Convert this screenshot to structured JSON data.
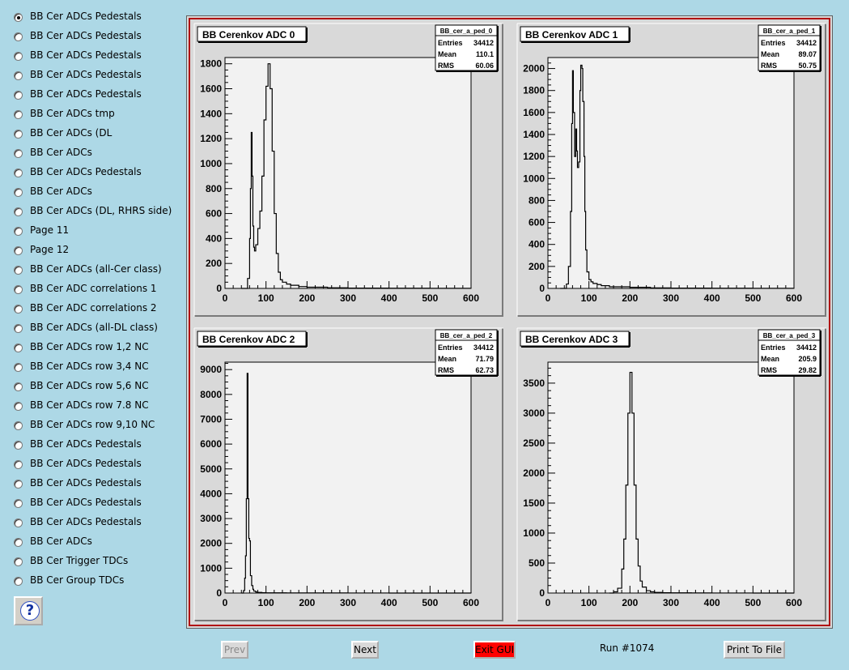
{
  "sidebar": {
    "items": [
      {
        "label": "BB Cer ADCs Pedestals",
        "checked": true
      },
      {
        "label": "BB Cer ADCs Pedestals",
        "checked": false
      },
      {
        "label": "BB Cer ADCs Pedestals",
        "checked": false
      },
      {
        "label": "BB Cer ADCs Pedestals",
        "checked": false
      },
      {
        "label": "BB Cer ADCs Pedestals",
        "checked": false
      },
      {
        "label": "BB Cer ADCs tmp",
        "checked": false
      },
      {
        "label": "BB Cer ADCs (DL",
        "checked": false
      },
      {
        "label": "BB Cer ADCs",
        "checked": false
      },
      {
        "label": "BB Cer ADCs Pedestals",
        "checked": false
      },
      {
        "label": "BB Cer ADCs",
        "checked": false
      },
      {
        "label": "BB Cer ADCs (DL, RHRS side)",
        "checked": false
      },
      {
        "label": "Page 11",
        "checked": false
      },
      {
        "label": "Page 12",
        "checked": false
      },
      {
        "label": "BB Cer ADCs (all-Cer class)",
        "checked": false
      },
      {
        "label": "BB Cer ADC correlations 1",
        "checked": false
      },
      {
        "label": "BB Cer ADC correlations 2",
        "checked": false
      },
      {
        "label": "BB Cer ADCs (all-DL class)",
        "checked": false
      },
      {
        "label": "BB Cer ADCs row 1,2 NC",
        "checked": false
      },
      {
        "label": "BB Cer ADCs row 3,4 NC",
        "checked": false
      },
      {
        "label": "BB Cer ADCs row 5,6 NC",
        "checked": false
      },
      {
        "label": "BB Cer ADCs row 7.8 NC",
        "checked": false
      },
      {
        "label": "BB Cer ADCs row 9,10 NC",
        "checked": false
      },
      {
        "label": "BB Cer ADCs Pedestals",
        "checked": false
      },
      {
        "label": "BB Cer ADCs Pedestals",
        "checked": false
      },
      {
        "label": "BB Cer ADCs Pedestals",
        "checked": false
      },
      {
        "label": "BB Cer ADCs Pedestals",
        "checked": false
      },
      {
        "label": "BB Cer ADCs Pedestals",
        "checked": false
      },
      {
        "label": "BB Cer ADCs",
        "checked": false
      },
      {
        "label": "BB Cer Trigger TDCs",
        "checked": false
      },
      {
        "label": "BB Cer Group TDCs",
        "checked": false
      }
    ],
    "help_icon": "question-mark-icon",
    "help_symbol": "?"
  },
  "bottom_bar": {
    "prev_label": "Prev",
    "next_label": "Next",
    "exit_label": "Exit GUI",
    "run_label": "Run #1074",
    "print_label": "Print To File"
  },
  "colors": {
    "background": "#add8e6",
    "canvas_border": "#b01010",
    "exit_button": "#ff0000",
    "plot_area": "#f2f2f2"
  },
  "chart_data": [
    {
      "type": "histogram",
      "title": "BB Cerenkov ADC 0",
      "stats": {
        "name": "BB_cer_a_ped_0",
        "Entries": "34412",
        "Mean": "110.1",
        "RMS": "60.06"
      },
      "xlim": [
        0,
        600
      ],
      "ylim": [
        0,
        1850
      ],
      "xticks": [
        0,
        100,
        200,
        300,
        400,
        500,
        600
      ],
      "yticks": [
        0,
        200,
        400,
        600,
        800,
        1000,
        1200,
        1400,
        1600,
        1800
      ],
      "x": [
        40,
        50,
        55,
        60,
        62,
        64,
        66,
        68,
        70,
        72,
        75,
        80,
        85,
        90,
        95,
        100,
        105,
        110,
        115,
        120,
        125,
        130,
        135,
        140,
        150,
        160,
        180,
        200,
        250,
        300,
        400,
        500,
        600
      ],
      "y": [
        0,
        0,
        80,
        400,
        800,
        1250,
        900,
        500,
        330,
        300,
        350,
        480,
        620,
        900,
        1350,
        1620,
        1800,
        1600,
        1100,
        600,
        280,
        130,
        70,
        50,
        35,
        25,
        15,
        10,
        5,
        3,
        2,
        1,
        0
      ]
    },
    {
      "type": "histogram",
      "title": "BB Cerenkov ADC 1",
      "stats": {
        "name": "BB_cer_a_ped_1",
        "Entries": "34412",
        "Mean": "89.07",
        "RMS": "50.75"
      },
      "xlim": [
        0,
        600
      ],
      "ylim": [
        0,
        2100
      ],
      "xticks": [
        0,
        100,
        200,
        300,
        400,
        500,
        600
      ],
      "yticks": [
        0,
        200,
        400,
        600,
        800,
        1000,
        1200,
        1400,
        1600,
        1800,
        2000
      ],
      "x": [
        30,
        40,
        45,
        50,
        55,
        58,
        60,
        62,
        65,
        68,
        70,
        72,
        75,
        78,
        80,
        83,
        85,
        88,
        90,
        92,
        95,
        100,
        105,
        110,
        120,
        130,
        150,
        200,
        250,
        300,
        400,
        500,
        600
      ],
      "y": [
        0,
        0,
        40,
        200,
        700,
        1500,
        1980,
        1600,
        1200,
        1450,
        1250,
        1100,
        1150,
        1800,
        2030,
        2000,
        1700,
        1200,
        700,
        350,
        150,
        80,
        60,
        45,
        35,
        25,
        15,
        10,
        5,
        3,
        2,
        1,
        0
      ]
    },
    {
      "type": "histogram",
      "title": "BB Cerenkov ADC 2",
      "stats": {
        "name": "BB_cer_a_ped_2",
        "Entries": "34412",
        "Mean": "71.79",
        "RMS": "62.73"
      },
      "xlim": [
        0,
        600
      ],
      "ylim": [
        0,
        9300
      ],
      "xticks": [
        0,
        100,
        200,
        300,
        400,
        500,
        600
      ],
      "yticks": [
        0,
        1000,
        2000,
        3000,
        4000,
        5000,
        6000,
        7000,
        8000,
        9000
      ],
      "x": [
        40,
        45,
        48,
        50,
        52,
        54,
        56,
        58,
        60,
        62,
        65,
        68,
        70,
        75,
        80,
        90,
        100,
        150,
        200,
        300,
        400,
        500,
        600
      ],
      "y": [
        0,
        100,
        600,
        1500,
        3800,
        8850,
        3800,
        2200,
        2100,
        700,
        300,
        150,
        80,
        40,
        25,
        15,
        10,
        6,
        4,
        2,
        1,
        1,
        0
      ]
    },
    {
      "type": "histogram",
      "title": "BB Cerenkov ADC 3",
      "stats": {
        "name": "BB_cer_a_ped_3",
        "Entries": "34412",
        "Mean": "205.9",
        "RMS": "29.82"
      },
      "xlim": [
        0,
        600
      ],
      "ylim": [
        0,
        3850
      ],
      "xticks": [
        0,
        100,
        200,
        300,
        400,
        500,
        600
      ],
      "yticks": [
        0,
        500,
        1000,
        1500,
        2000,
        2500,
        3000,
        3500
      ],
      "x": [
        150,
        160,
        170,
        180,
        185,
        190,
        195,
        200,
        205,
        210,
        215,
        220,
        225,
        230,
        240,
        250,
        260,
        280,
        300,
        350,
        400,
        500,
        600
      ],
      "y": [
        0,
        20,
        80,
        400,
        900,
        1800,
        3000,
        3680,
        3000,
        1800,
        900,
        450,
        200,
        100,
        40,
        20,
        10,
        5,
        3,
        2,
        1,
        0,
        0
      ]
    }
  ]
}
